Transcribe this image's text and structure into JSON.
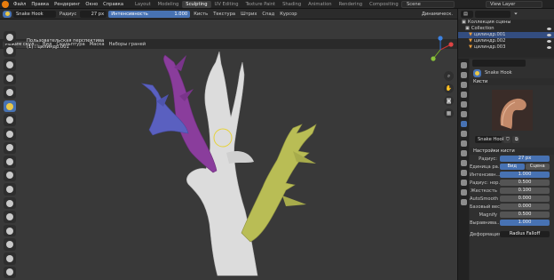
{
  "menu": [
    "Файл",
    "Правка",
    "Рендеринг",
    "Окно",
    "Справка"
  ],
  "workspaces": [
    {
      "label": "Layout",
      "active": false
    },
    {
      "label": "Modeling",
      "active": false
    },
    {
      "label": "Sculpting",
      "active": true
    },
    {
      "label": "UV Editing",
      "active": false
    },
    {
      "label": "Texture Paint",
      "active": false
    },
    {
      "label": "Shading",
      "active": false
    },
    {
      "label": "Animation",
      "active": false
    },
    {
      "label": "Rendering",
      "active": false
    },
    {
      "label": "Compositing",
      "active": false
    }
  ],
  "scene": "Scene",
  "view_layer": "View Layer",
  "tool_header": {
    "brush": "Snake Hook",
    "radius_label": "Радиус",
    "radius_value": "27 px",
    "strength_label": "Интенсивность",
    "strength_value": "1.000",
    "brush_menu": "Кисть",
    "texture_menu": "Текстура",
    "stroke_menu": "Штрих",
    "falloff_menu": "Спад",
    "cursor_menu": "Курсор",
    "dynamic": "Динамическ."
  },
  "view_header": {
    "mode": "Режим скул...",
    "items": [
      "Вид",
      "Скульптура",
      "Маска",
      "Наборы граней"
    ]
  },
  "viewport": {
    "perspective": "Пользовательская перспектива",
    "object": "(1) : цилиндр.001"
  },
  "outliner": {
    "scene_collection": "Коллекция сцены",
    "collection": "Collection",
    "objects": [
      "цилиндр.001",
      "цилиндр.002",
      "цилиндр.003"
    ]
  },
  "properties": {
    "tool_name": "Snake Hook",
    "brushes_section": "Кисти",
    "brush_name": "Snake Hook",
    "brush_settings": "Настройки кисти",
    "radius_label": "Радиус:",
    "radius_value": "27 px",
    "radius_unit_label": "Единица ра...",
    "radius_unit_view": "Вид",
    "radius_unit_scene": "Сцена",
    "strength_label": "Интенсивн...",
    "strength_value": "1.000",
    "normal_radius_label": "Радиус: нор...",
    "normal_radius_value": "0.500",
    "hardness_label": "Жесткость",
    "hardness_value": "0.100",
    "autosmooth_label": "AutoSmooth",
    "autosmooth_value": "0.000",
    "base_weight_label": "Базовый вес",
    "base_weight_value": "0.000",
    "magnify_label": "Magnify",
    "magnify_value": "0.500",
    "alignment_label": "Выравнива...",
    "alignment_value": "1.000",
    "deformation_label": "Деформация",
    "deformation_value": "Radius Falloff"
  },
  "colors": {
    "accent": "#4772b3",
    "brand_orange": "#e87d0d",
    "purple_branch": "#8a3d9c",
    "blue_branch": "#5a60c0",
    "yellow_branch": "#b9bd55",
    "trunk": "#dcdcdc",
    "brush_circle": "#e6d23c"
  }
}
